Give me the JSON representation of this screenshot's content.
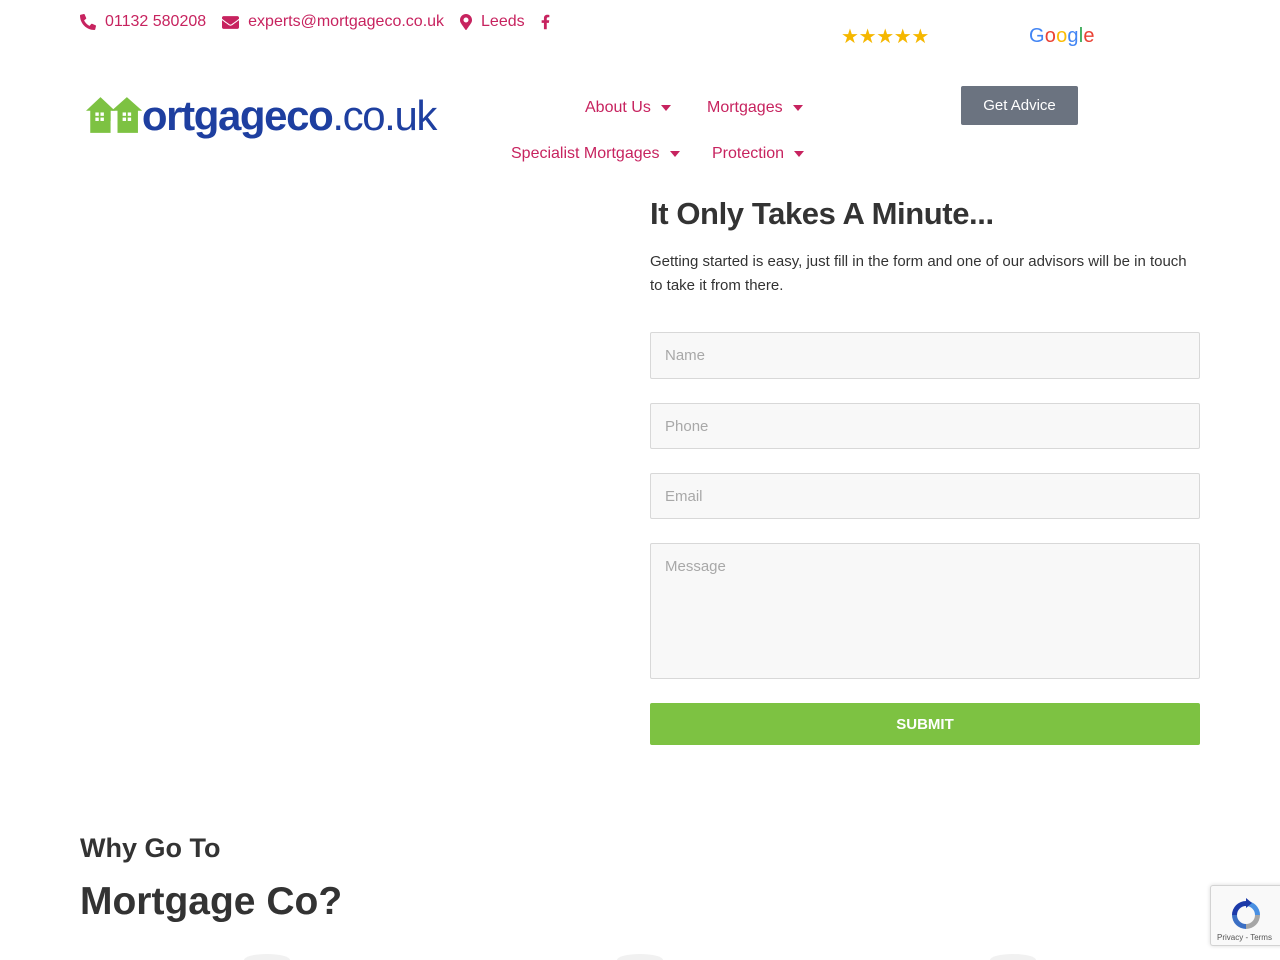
{
  "topbar": {
    "phone": "01132 580208",
    "email": "experts@mortgageco.co.uk",
    "location": "Leeds",
    "social_icon": "facebook-icon"
  },
  "reviews": {
    "stars": "★★★★★",
    "rating": 5,
    "provider_letters": [
      "G",
      "o",
      "o",
      "g",
      "l",
      "e"
    ],
    "provider_colors": [
      "#4285f4",
      "#ea4335",
      "#fbbc05",
      "#4285f4",
      "#34a853",
      "#ea4335"
    ]
  },
  "logo": {
    "name_bold": "ortgageco",
    "name_suffix": ".co.uk",
    "initial_icon": "house-m-icon"
  },
  "nav": {
    "about": "About Us",
    "mortgages": "Mortgages",
    "specialist": "Specialist Mortgages",
    "protection": "Protection",
    "cta": "Get Advice"
  },
  "form": {
    "title": "It Only Takes A Minute...",
    "intro": "Getting started is easy, just fill in the form and one of our advisors will be in touch to take it from there.",
    "name_placeholder": "Name",
    "phone_placeholder": "Phone",
    "email_placeholder": "Email",
    "message_placeholder": "Message",
    "submit_label": "SUBMIT"
  },
  "why": {
    "subtitle": "Why Go To",
    "title": "Mortgage Co?"
  },
  "recaptcha": {
    "links": "Privacy - Terms"
  },
  "colors": {
    "accent": "#c7235f",
    "brand_green": "#7dc242",
    "brand_blue": "#1e3fa0",
    "button_grey": "#6b7380",
    "star": "#f5b700"
  }
}
